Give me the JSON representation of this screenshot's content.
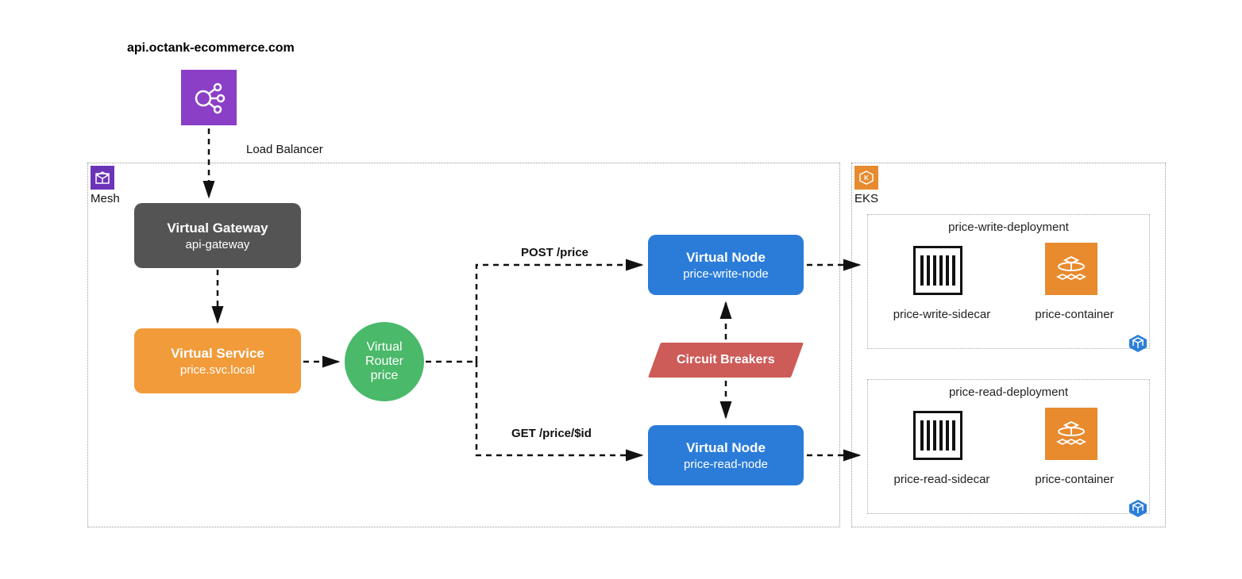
{
  "title": "api.octank-ecommerce.com",
  "load_balancer_label": "Load Balancer",
  "mesh": {
    "label": "Mesh",
    "gateway": {
      "title": "Virtual Gateway",
      "subtitle": "api-gateway"
    },
    "service": {
      "title": "Virtual Service",
      "subtitle": "price.svc.local"
    },
    "router": {
      "title": "Virtual",
      "title2": "Router",
      "subtitle": "price"
    },
    "routes": {
      "post": "POST /price",
      "get": "GET /price/$id"
    },
    "node_write": {
      "title": "Virtual Node",
      "subtitle": "price-write-node"
    },
    "node_read": {
      "title": "Virtual Node",
      "subtitle": "price-read-node"
    },
    "circuit_breakers": "Circuit Breakers"
  },
  "eks": {
    "label": "EKS",
    "write_deploy": {
      "label": "price-write-deployment",
      "sidecar_label": "price-write-sidecar",
      "container_label": "price-container"
    },
    "read_deploy": {
      "label": "price-read-deployment",
      "sidecar_label": "price-read-sidecar",
      "container_label": "price-container"
    }
  },
  "colors": {
    "purple": "#8b3fc7",
    "dark": "#545454",
    "amber": "#f29b3a",
    "green": "#4ab96a",
    "blue": "#2a7cd8",
    "red": "#cd5b58",
    "orange": "#e88a2e",
    "badge_blue": "#2b7fd8"
  }
}
